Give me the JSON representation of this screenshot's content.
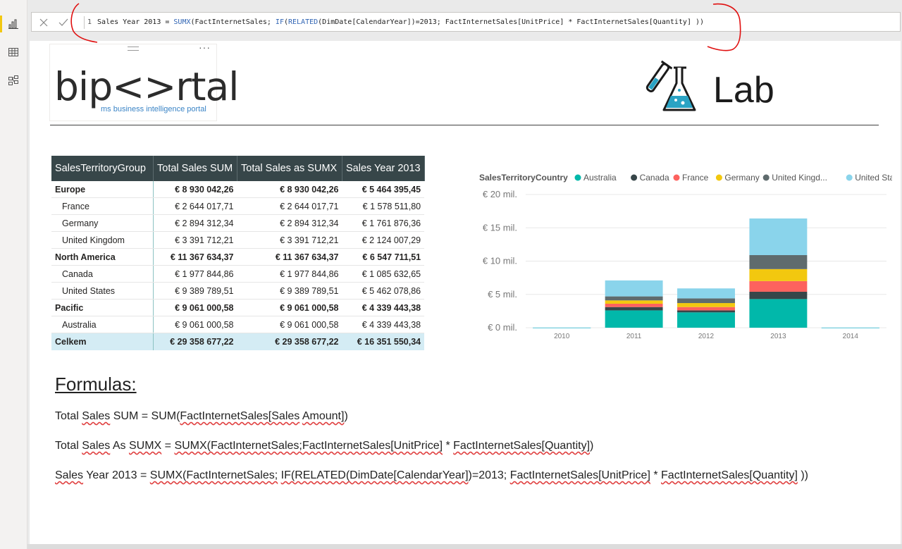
{
  "sidebar": {
    "items": [
      {
        "name": "report-view",
        "icon": "bar-chart-icon"
      },
      {
        "name": "data-view",
        "icon": "table-icon"
      },
      {
        "name": "model-view",
        "icon": "model-icon"
      }
    ]
  },
  "formula_bar": {
    "line_number": "1",
    "parts": {
      "p1": "Sales Year 2013 = ",
      "p2": "SUMX",
      "p3": "(FactInternetSales; ",
      "p4": "IF",
      "p5": "(",
      "p6": "RELATED",
      "p7": "(DimDate[CalendarYear])=2013; FactInternetSales[UnitPrice] * FactInternetSales[Quantity] ))"
    }
  },
  "header": {
    "logo_text": "bip<>rtal",
    "logo_subtitle": "ms business intelligence portal",
    "more_glyph": "···",
    "lab_label": "Lab"
  },
  "matrix": {
    "columns": [
      "SalesTerritoryGroup",
      "Total Sales SUM",
      "Total Sales as SUMX",
      "Sales Year 2013"
    ],
    "rows": [
      {
        "type": "group",
        "cells": [
          "Europe",
          "€ 8 930 042,26",
          "€ 8 930 042,26",
          "€ 5 464 395,45"
        ]
      },
      {
        "type": "child",
        "cells": [
          "France",
          "€ 2 644 017,71",
          "€ 2 644 017,71",
          "€ 1 578 511,80"
        ]
      },
      {
        "type": "child",
        "cells": [
          "Germany",
          "€ 2 894 312,34",
          "€ 2 894 312,34",
          "€ 1 761 876,36"
        ]
      },
      {
        "type": "child",
        "cells": [
          "United Kingdom",
          "€ 3 391 712,21",
          "€ 3 391 712,21",
          "€ 2 124 007,29"
        ]
      },
      {
        "type": "group",
        "cells": [
          "North America",
          "€ 11 367 634,37",
          "€ 11 367 634,37",
          "€ 6 547 711,51"
        ]
      },
      {
        "type": "child",
        "cells": [
          "Canada",
          "€ 1 977 844,86",
          "€ 1 977 844,86",
          "€ 1 085 632,65"
        ]
      },
      {
        "type": "child",
        "cells": [
          "United States",
          "€ 9 389 789,51",
          "€ 9 389 789,51",
          "€ 5 462 078,86"
        ]
      },
      {
        "type": "group",
        "cells": [
          "Pacific",
          "€ 9 061 000,58",
          "€ 9 061 000,58",
          "€ 4 339 443,38"
        ]
      },
      {
        "type": "child",
        "cells": [
          "Australia",
          "€ 9 061 000,58",
          "€ 9 061 000,58",
          "€ 4 339 443,38"
        ]
      },
      {
        "type": "total",
        "cells": [
          "Celkem",
          "€ 29 358 677,22",
          "€ 29 358 677,22",
          "€ 16 351 550,34"
        ]
      }
    ]
  },
  "chart_data": {
    "type": "bar",
    "stacked": true,
    "legend_title": "SalesTerritoryCountry",
    "legend_position": "top",
    "categories": [
      "2010",
      "2011",
      "2012",
      "2013",
      "2014"
    ],
    "ylim": [
      0,
      20
    ],
    "yticks": [
      "€ 0 mil.",
      "€ 5 mil.",
      "€ 10 mil.",
      "€ 15 mil.",
      "€ 20 mil."
    ],
    "grid": true,
    "series": [
      {
        "name": "Australia",
        "color": "#01b8aa",
        "values": [
          0.01,
          2.6,
          2.3,
          4.3,
          0.01
        ]
      },
      {
        "name": "Canada",
        "color": "#374649",
        "values": [
          0,
          0.5,
          0.3,
          1.1,
          0
        ]
      },
      {
        "name": "France",
        "color": "#fd625e",
        "values": [
          0,
          0.5,
          0.5,
          1.6,
          0
        ]
      },
      {
        "name": "Germany",
        "color": "#f2c80f",
        "values": [
          0,
          0.5,
          0.6,
          1.8,
          0
        ]
      },
      {
        "name": "United Kingd...",
        "color": "#5f6b6d",
        "values": [
          0,
          0.6,
          0.7,
          2.1,
          0
        ]
      },
      {
        "name": "United States",
        "color": "#8ad4eb",
        "values": [
          0.01,
          2.4,
          1.5,
          5.5,
          0.01
        ]
      }
    ]
  },
  "formulas": {
    "title": "Formulas:",
    "line1": {
      "a": "Total ",
      "b": "Sales",
      "c": " SUM = SUM(",
      "d": "FactInternetSales[Sales",
      "e": " ",
      "f": "Amount]",
      "g": ")"
    },
    "line2": {
      "a": "Total ",
      "b": "Sales",
      "c": " As ",
      "d": "SUMX",
      "e": " = ",
      "f": "SUMX(FactInternetSales;FactInternetSales[UnitPrice]",
      "g": " * ",
      "h": "FactInternetSales[Quantity]",
      "i": ")"
    },
    "line3": {
      "a": "Sales",
      "b": " Year 2013 = ",
      "c": "SUMX(FactInternetSales;",
      "d": " ",
      "e": "IF(RELATED(DimDate[CalendarYear]",
      "f": ")=2013; ",
      "g": "FactInternetSales[UnitPrice]",
      "h": " * ",
      "i": "FactInternetSales[Quantity]",
      "j": " ))"
    }
  }
}
